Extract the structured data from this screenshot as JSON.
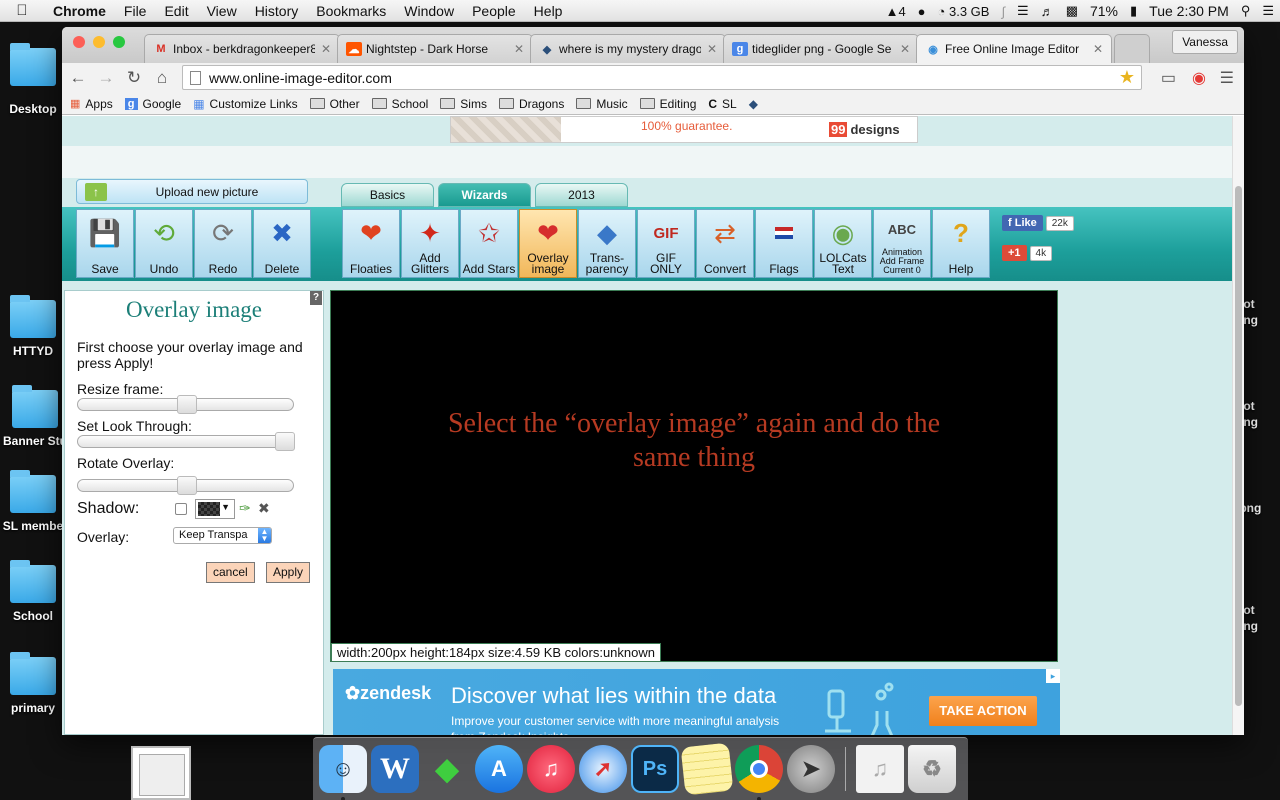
{
  "menubar": {
    "app_name": "Chrome",
    "items": [
      "File",
      "Edit",
      "View",
      "History",
      "Bookmarks",
      "Window",
      "People",
      "Help"
    ],
    "status": {
      "notification_count": "4",
      "memory": "3.3 GB",
      "battery": "71%",
      "clock": "Tue 2:30 PM"
    }
  },
  "desktop": {
    "left_items": [
      "Desktop",
      "HTTYD",
      "Banner Stu",
      "SL membe",
      "School",
      "primary"
    ],
    "right_items": [
      "not\npng",
      "not\npng",
      ".png",
      "not\npng"
    ]
  },
  "browser": {
    "tabs": [
      {
        "title": "Inbox - berkdragonkeeper8",
        "favicon": "M"
      },
      {
        "title": "Nightstep - Dark Horse",
        "favicon": "☁"
      },
      {
        "title": "where is my mystery drago",
        "favicon": "◆"
      },
      {
        "title": "tideglider png - Google Se",
        "favicon": "g"
      },
      {
        "title": "Free Online Image Editor",
        "favicon": "◉"
      }
    ],
    "profile": "Vanessa",
    "url": "www.online-image-editor.com",
    "bookmarks": [
      "Apps",
      "Google",
      "Customize Links",
      "Other",
      "School",
      "Sims",
      "Dragons",
      "Music",
      "Editing",
      "SL"
    ]
  },
  "page": {
    "top_ad": {
      "text": "100% guarantee.",
      "logo_badge": "99",
      "logo_text": "designs"
    },
    "upload_label": "Upload new picture",
    "section_tabs": [
      "Basics",
      "Wizards",
      "2013"
    ],
    "active_section_tab": "Wizards",
    "tools": {
      "save": "Save",
      "undo": "Undo",
      "redo": "Redo",
      "delete": "Delete",
      "floaties": "Floaties",
      "glitters_1": "Add",
      "glitters_2": "Glitters",
      "stars": "Add Stars",
      "overlay_1": "Overlay",
      "overlay_2": "image",
      "trans_1": "Trans-",
      "trans_2": "parency",
      "gif_1": "GIF",
      "gif_2": "ONLY",
      "convert": "Convert",
      "flags": "Flags",
      "lol_1": "LOLCats",
      "lol_2": "Text",
      "anim_1": "Animation",
      "anim_2": "Add Frame",
      "anim_3": "Current 0",
      "help": "Help"
    },
    "social": {
      "like_label": "Like",
      "like_count": "22k",
      "gplus_label": "+1",
      "gplus_count": "4k"
    },
    "panel": {
      "title": "Overlay image",
      "help_badge": "?",
      "intro": "First choose your overlay image and press Apply!",
      "resize_label": "Resize frame:",
      "look_through_label": "Set Look Through:",
      "rotate_label": "Rotate Overlay:",
      "resize_value": 0.5,
      "look_through_value": 1.0,
      "rotate_value": 0.5,
      "shadow_label": "Shadow:",
      "shadow_checked": false,
      "overlay_label": "Overlay:",
      "overlay_value": "Keep Transpa",
      "cancel_label": "cancel",
      "apply_label": "Apply"
    },
    "canvas": {
      "message_line1": "Select the “overlay image” again and do the",
      "message_line2": "same thing",
      "info": "width:200px  height:184px  size:4.59 KB  colors:unknown"
    },
    "bottom_ad": {
      "brand": "zendesk",
      "headline": "Discover what lies within the data",
      "sub": "Improve your customer service with more meaningful analysis from Zendesk Insights.",
      "cta": "TAKE ACTION"
    }
  },
  "dock": [
    "Finder",
    "W",
    "Sims",
    "App Store",
    "iTunes",
    "Safari",
    "Ps",
    "Notes",
    "Chrome",
    "Launchpad",
    "Documents",
    "Trash"
  ]
}
